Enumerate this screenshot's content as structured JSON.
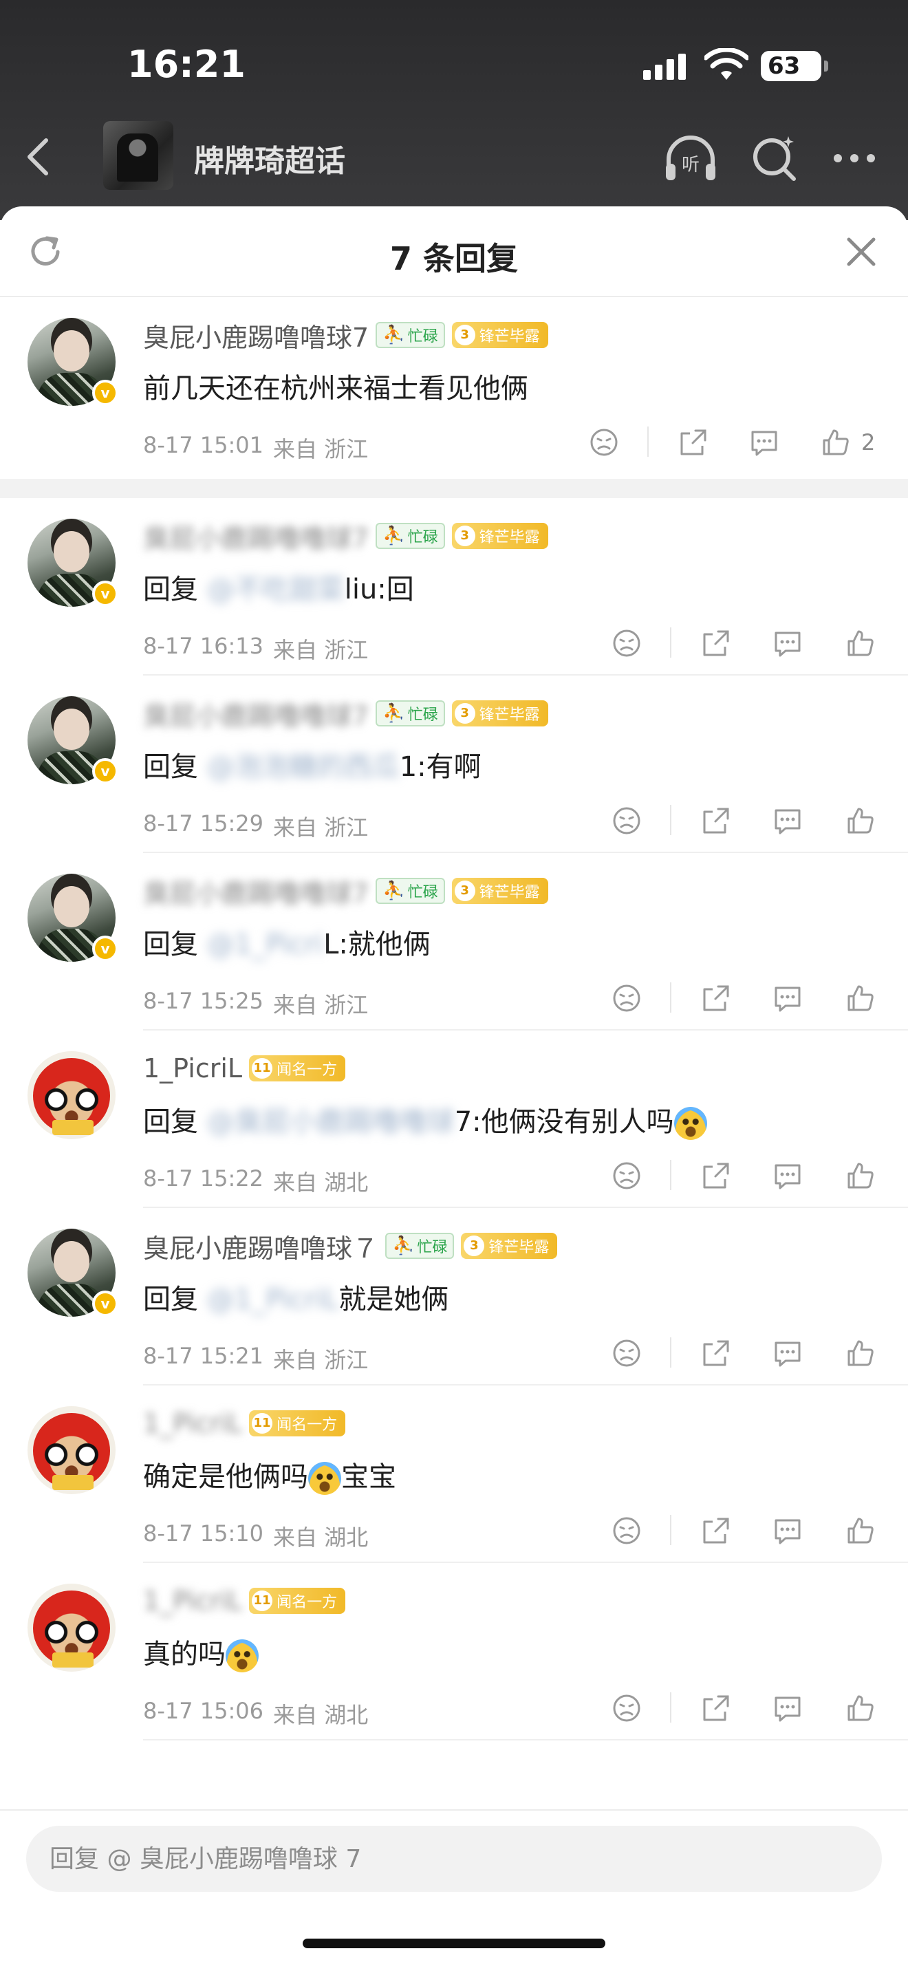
{
  "status": {
    "time": "16:21",
    "battery": "63"
  },
  "nav": {
    "group_name": "牌牌琦超话",
    "listen_label": "听"
  },
  "sheet": {
    "title": "7 条回复"
  },
  "reply_input": {
    "placeholder": "回复 @ 臭屁小鹿踢噜噜球 7"
  },
  "top_comment": {
    "username": "臭屁小鹿踢噜噜球7",
    "tag_green": "忙碌",
    "tag_gold_level": "3",
    "tag_gold": "锋芒毕露",
    "text": "前几天还在杭州来福士看见他俩",
    "date": "8-17 15:01",
    "from": "来自 浙江",
    "likes": "2"
  },
  "replies": [
    {
      "username": "臭屁小鹿踢噜噜球7",
      "tag_green": "忙碌",
      "tag_gold_level": "3",
      "tag_gold": "锋芒毕露",
      "prefix": "回复",
      "mention_blur": "@不吃甜菜",
      "mention_visible": "liu",
      "suffix": ":回",
      "date": "8-17 16:13",
      "from": "来自 浙江"
    },
    {
      "username": "臭屁小鹿踢噜噜球7",
      "tag_green": "忙碌",
      "tag_gold_level": "3",
      "tag_gold": "锋芒毕露",
      "prefix": "回复",
      "mention_blur": "@泡泡糖的西瓜",
      "mention_visible": "1",
      "suffix": ":有啊",
      "date": "8-17 15:29",
      "from": "来自 浙江"
    },
    {
      "username": "臭屁小鹿踢噜噜球7",
      "tag_green": "忙碌",
      "tag_gold_level": "3",
      "tag_gold": "锋芒毕露",
      "prefix": "回复",
      "mention_blur": "@1_Picri",
      "mention_visible": "L",
      "suffix": ":就他俩",
      "date": "8-17 15:25",
      "from": "来自 浙江"
    },
    {
      "username": "1_PicriL",
      "tag_gold_level": "11",
      "tag_gold": "闻名一方",
      "prefix": "回复",
      "mention_blur": "@臭屁小鹿踢噜噜球",
      "mention_visible": "7",
      "suffix": ":他俩没有别人吗",
      "emoji": "cry",
      "date": "8-17 15:22",
      "from": "来自 湖北"
    },
    {
      "username": "臭屁小鹿踢噜噜球７",
      "tag_green": "忙碌",
      "tag_gold_level": "3",
      "tag_gold": "锋芒毕露",
      "prefix": "回复",
      "mention_blur": "@1_PicriL",
      "mention_visible": "",
      "suffix": "就是她俩",
      "date": "8-17 15:21",
      "from": "来自 浙江"
    },
    {
      "username": "1_PicriL",
      "tag_gold_level": "11",
      "tag_gold": "闻名一方",
      "prefix": "确定是他俩吗",
      "mention_blur": "",
      "mention_visible": "",
      "suffix": "宝宝",
      "emoji": "cry",
      "date": "8-17 15:10",
      "from": "来自 湖北"
    },
    {
      "username": "1_PicriL",
      "tag_gold_level": "11",
      "tag_gold": "闻名一方",
      "prefix": "真的吗",
      "mention_blur": "",
      "mention_visible": "",
      "suffix": "",
      "emoji": "cry",
      "date": "8-17 15:06",
      "from": "来自 湖北"
    }
  ]
}
